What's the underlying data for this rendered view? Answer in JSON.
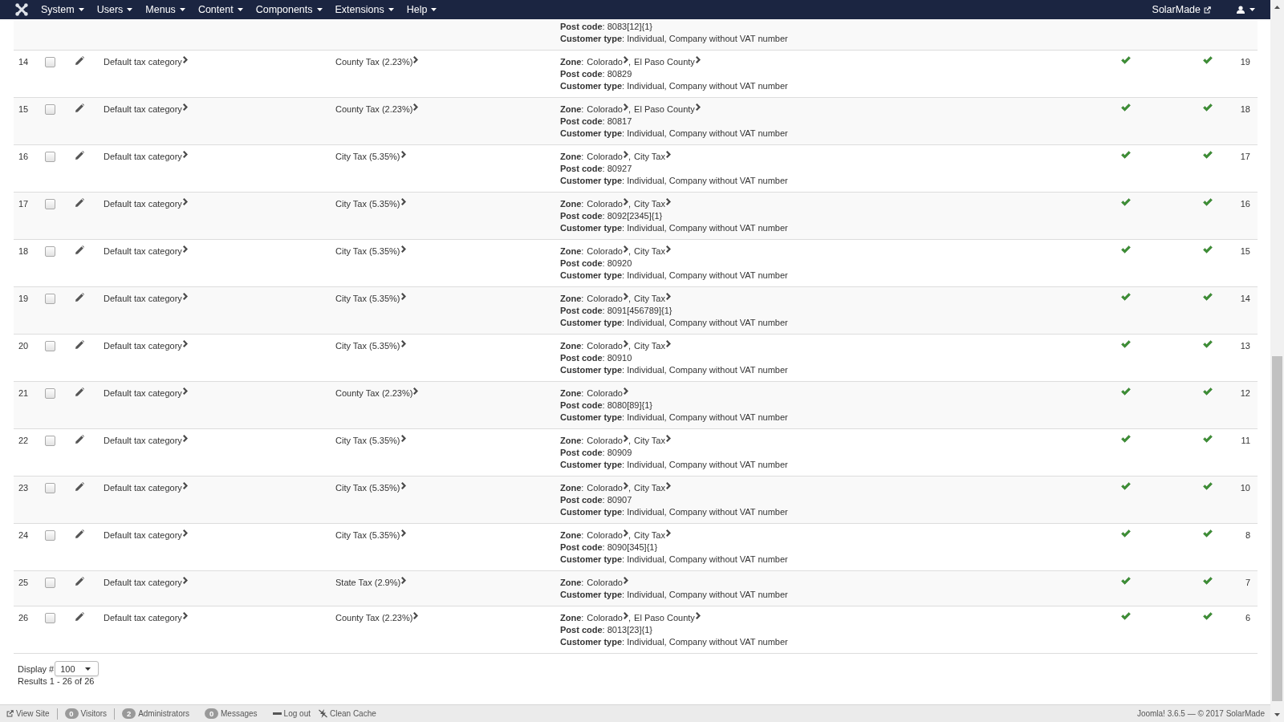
{
  "navbar": {
    "menu": [
      "System",
      "Users",
      "Menus",
      "Content",
      "Components",
      "Extensions",
      "Help"
    ],
    "site_name": "SolarMade"
  },
  "partial_row": {
    "post_code": "**Post code**: 8083[12]{1}",
    "customer_type": "**Customer type**: Individual, Company without VAT number"
  },
  "rows": [
    {
      "number": "14",
      "checked": false,
      "tax_category": "Default tax category",
      "tax_rate": "County Tax (2.23%)",
      "zone_label": "**Zone**:",
      "zones": [
        "Colorado",
        "El Paso County"
      ],
      "zone_separator": ",",
      "post_code": "**Post code**: 80829",
      "customer_type": "**Customer type**: Individual, Company without VAT number",
      "checks": [
        true,
        true
      ],
      "ordering": "19"
    },
    {
      "number": "15",
      "checked": false,
      "tax_category": "Default tax category",
      "tax_rate": "County Tax (2.23%)",
      "zone_label": "**Zone**:",
      "zones": [
        "Colorado",
        "El Paso County"
      ],
      "zone_separator": ",",
      "post_code": "**Post code**: 80817",
      "customer_type": "**Customer type**: Individual, Company without VAT number",
      "checks": [
        true,
        true
      ],
      "ordering": "18"
    },
    {
      "number": "16",
      "checked": false,
      "tax_category": "Default tax category",
      "tax_rate": "City Tax (5.35%)",
      "zone_label": "**Zone**:",
      "zones": [
        "Colorado",
        "City Tax"
      ],
      "zone_separator": ",",
      "post_code": "**Post code**: 80927",
      "customer_type": "**Customer type**: Individual, Company without VAT number",
      "checks": [
        true,
        true
      ],
      "ordering": "17"
    },
    {
      "number": "17",
      "checked": false,
      "tax_category": "Default tax category",
      "tax_rate": "City Tax (5.35%)",
      "zone_label": "**Zone**:",
      "zones": [
        "Colorado",
        "City Tax"
      ],
      "zone_separator": ",",
      "post_code": "**Post code**: 8092[2345]{1}",
      "customer_type": "**Customer type**: Individual, Company without VAT number",
      "checks": [
        true,
        true
      ],
      "ordering": "16"
    },
    {
      "number": "18",
      "checked": false,
      "tax_category": "Default tax category",
      "tax_rate": "City Tax (5.35%)",
      "zone_label": "**Zone**:",
      "zones": [
        "Colorado",
        "City Tax"
      ],
      "zone_separator": ",",
      "post_code": "**Post code**: 80920",
      "customer_type": "**Customer type**: Individual, Company without VAT number",
      "checks": [
        true,
        true
      ],
      "ordering": "15"
    },
    {
      "number": "19",
      "checked": false,
      "tax_category": "Default tax category",
      "tax_rate": "City Tax (5.35%)",
      "zone_label": "**Zone**:",
      "zones": [
        "Colorado",
        "City Tax"
      ],
      "zone_separator": ",",
      "post_code": "**Post code**: 8091[456789]{1}",
      "customer_type": "**Customer type**: Individual, Company without VAT number",
      "checks": [
        true,
        true
      ],
      "ordering": "14"
    },
    {
      "number": "20",
      "checked": false,
      "tax_category": "Default tax category",
      "tax_rate": "City Tax (5.35%)",
      "zone_label": "**Zone**:",
      "zones": [
        "Colorado",
        "City Tax"
      ],
      "zone_separator": ",",
      "post_code": "**Post code**: 80910",
      "customer_type": "**Customer type**: Individual, Company without VAT number",
      "checks": [
        true,
        true
      ],
      "ordering": "13"
    },
    {
      "number": "21",
      "checked": false,
      "tax_category": "Default tax category",
      "tax_rate": "County Tax (2.23%)",
      "zone_label": "**Zone**:",
      "zones": [
        "Colorado"
      ],
      "post_code": "**Post code**: 8080[89]{1}",
      "customer_type": "**Customer type**: Individual, Company without VAT number",
      "checks": [
        true,
        true
      ],
      "ordering": "12"
    },
    {
      "number": "22",
      "checked": false,
      "tax_category": "Default tax category",
      "tax_rate": "City Tax (5.35%)",
      "zone_label": "**Zone**:",
      "zones": [
        "Colorado",
        "City Tax"
      ],
      "zone_separator": ",",
      "post_code": "**Post code**: 80909",
      "customer_type": "**Customer type**: Individual, Company without VAT number",
      "checks": [
        true,
        true
      ],
      "ordering": "11"
    },
    {
      "number": "23",
      "checked": false,
      "tax_category": "Default tax category",
      "tax_rate": "City Tax (5.35%)",
      "zone_label": "**Zone**:",
      "zones": [
        "Colorado",
        "City Tax"
      ],
      "zone_separator": ",",
      "post_code": "**Post code**: 80907",
      "customer_type": "**Customer type**: Individual, Company without VAT number",
      "checks": [
        true,
        true
      ],
      "ordering": "10"
    },
    {
      "number": "24",
      "checked": false,
      "tax_category": "Default tax category",
      "tax_rate": "City Tax (5.35%)",
      "zone_label": "**Zone**:",
      "zones": [
        "Colorado",
        "City Tax"
      ],
      "zone_separator": ",",
      "post_code": "**Post code**: 8090[345]{1}",
      "customer_type": "**Customer type**: Individual, Company without VAT number",
      "checks": [
        true,
        true
      ],
      "ordering": "8"
    },
    {
      "number": "25",
      "checked": false,
      "tax_category": "Default tax category",
      "tax_rate": "State Tax (2.9%)",
      "zone_label": "**Zone**:",
      "zones": [
        "Colorado"
      ],
      "customer_type": "**Customer type**: Individual, Company without VAT number",
      "checks": [
        true,
        true
      ],
      "ordering": "7"
    },
    {
      "number": "26",
      "checked": false,
      "tax_category": "Default tax category",
      "tax_rate": "County Tax (2.23%)",
      "zone_label": "**Zone**:",
      "zones": [
        "Colorado",
        "El Paso County"
      ],
      "zone_separator": ",",
      "post_code": "**Post code**: 8013[23]{1}",
      "customer_type": "**Customer type**: Individual, Company without VAT number",
      "checks": [
        true,
        true
      ],
      "ordering": "6"
    }
  ],
  "pagination": {
    "label": "Display #",
    "value": "100",
    "results": "Results 1 - 26 of 26"
  },
  "status_bar": {
    "items": [
      {
        "kind": "viewsite",
        "label": "View Site",
        "divider": true
      },
      {
        "kind": "badge",
        "count": "0",
        "label": "Visitors",
        "divider": true
      },
      {
        "kind": "badge",
        "count": "2",
        "label": "Administrators",
        "divider": false
      },
      {
        "kind": "badge",
        "count": "0",
        "label": "Messages",
        "divider": false
      },
      {
        "kind": "logout",
        "label": "Log out",
        "divider": false
      },
      {
        "kind": "cache",
        "label": "Clean Cache",
        "divider": false
      }
    ],
    "copyright": "Joomla! 3.6.5 — © 2017 SolarMade"
  }
}
